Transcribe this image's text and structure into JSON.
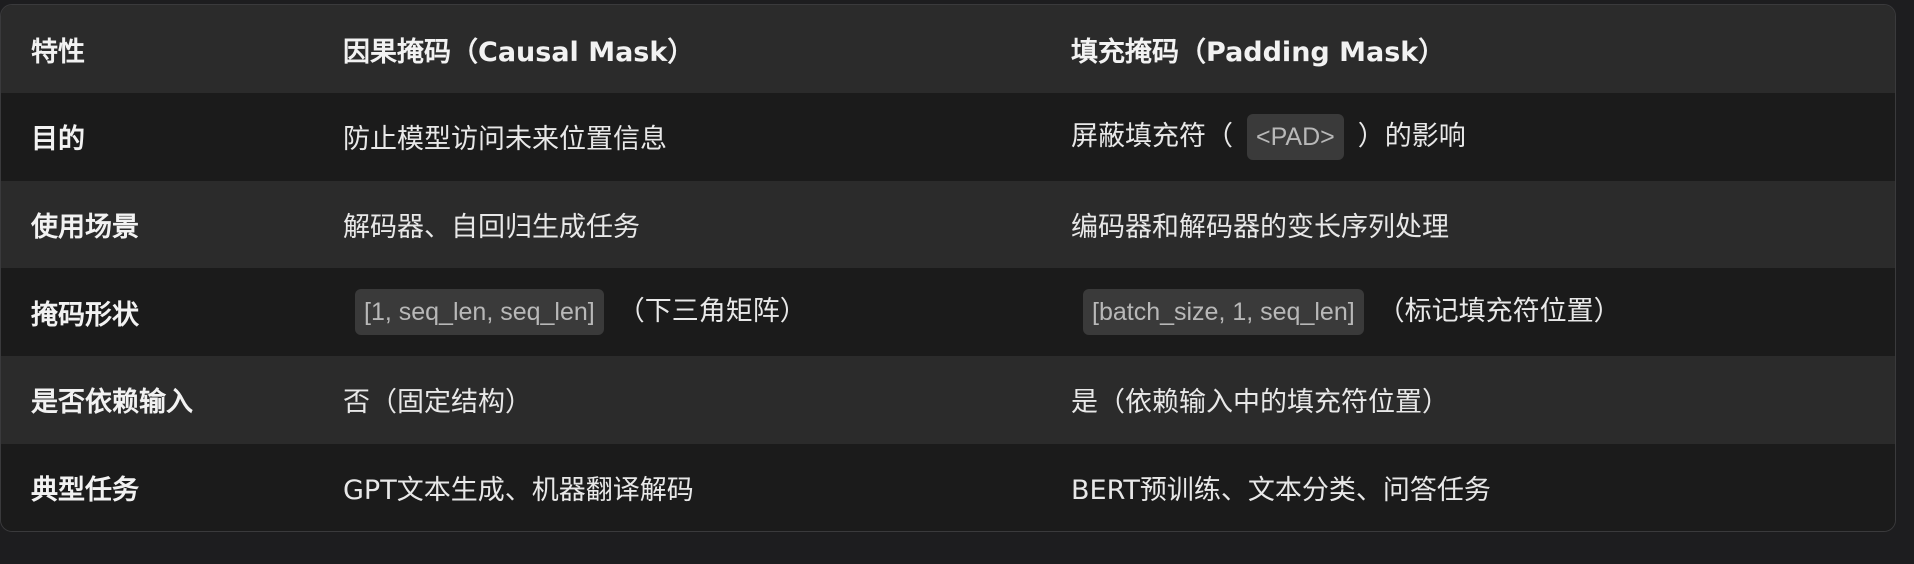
{
  "table": {
    "headers": [
      "特性",
      "因果掩码（Causal Mask）",
      "填充掩码（Padding Mask）"
    ],
    "rows": [
      {
        "feature": "目的",
        "causal": {
          "text": "防止模型访问未来位置信息"
        },
        "padding": {
          "before": "屏蔽填充符（",
          "code": "<PAD>",
          "after": "）的影响"
        }
      },
      {
        "feature": "使用场景",
        "causal": {
          "text": "解码器、自回归生成任务"
        },
        "padding": {
          "text": "编码器和解码器的变长序列处理"
        }
      },
      {
        "feature": "掩码形状",
        "causal": {
          "code": "[1, seq_len, seq_len]",
          "after": "（下三角矩阵）"
        },
        "padding": {
          "code": "[batch_size, 1, seq_len]",
          "after": "（标记填充符位置）"
        }
      },
      {
        "feature": "是否依赖输入",
        "causal": {
          "text": "否（固定结构）"
        },
        "padding": {
          "text": "是（依赖输入中的填充符位置）"
        }
      },
      {
        "feature": "典型任务",
        "causal": {
          "text": "GPT文本生成、机器翻译解码"
        },
        "padding": {
          "text": "BERT预训练、文本分类、问答任务"
        }
      }
    ]
  },
  "colors": {
    "page_bg": "#1d1d1f",
    "header_bg": "#2b2b2b",
    "row_dark": "#1b1b1b",
    "row_light": "#2b2b2b",
    "code_bg": "#3a3a3a",
    "text": "#e8e8e8"
  }
}
